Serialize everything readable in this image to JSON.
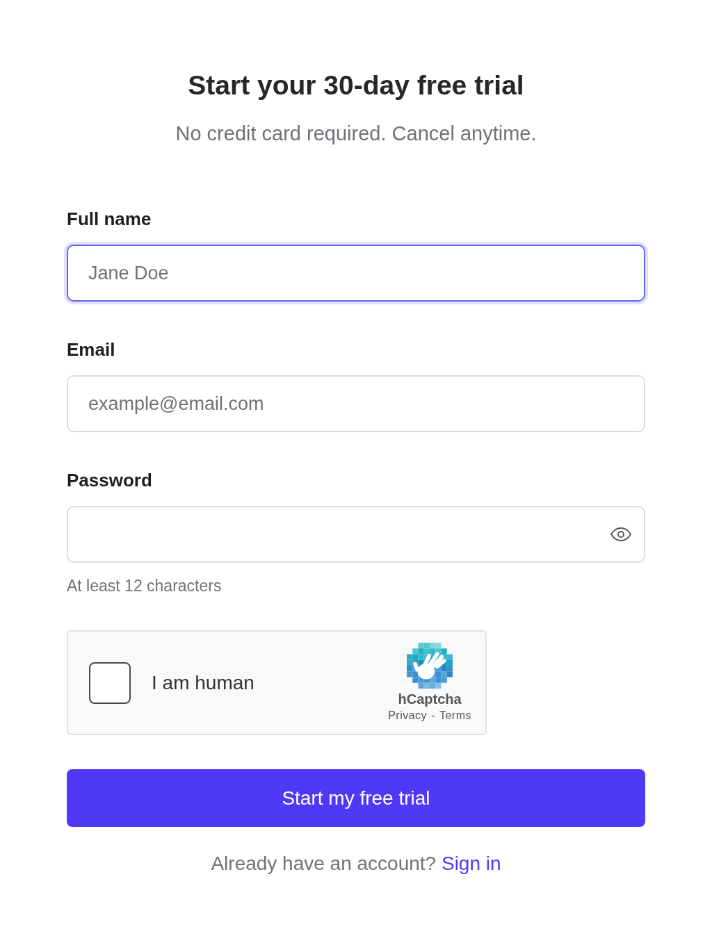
{
  "header": {
    "title": "Start your 30-day free trial",
    "subtitle": "No credit card required. Cancel anytime."
  },
  "fields": [
    {
      "label": "Full name",
      "placeholder": "Jane Doe",
      "kind": "text",
      "focused": true
    },
    {
      "label": "Email",
      "placeholder": "example@email.com",
      "kind": "email",
      "focused": false
    },
    {
      "label": "Password",
      "kind": "password",
      "focused": false,
      "hint": "At least 12 characters"
    }
  ],
  "captcha": {
    "label": "I am human",
    "checked": false,
    "brand": "hCaptcha",
    "links": [
      "Privacy",
      "Terms"
    ],
    "separator": "-"
  },
  "submit_button": "Start my free trial",
  "footer": {
    "text": "Already have an account?",
    "link": "Sign in"
  }
}
